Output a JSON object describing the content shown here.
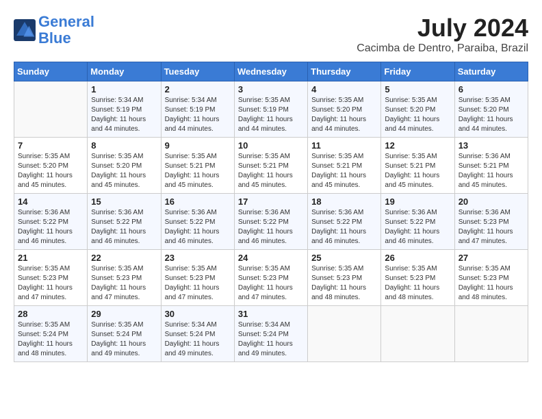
{
  "header": {
    "logo_line1": "General",
    "logo_line2": "Blue",
    "month_year": "July 2024",
    "location": "Cacimba de Dentro, Paraiba, Brazil"
  },
  "days_of_week": [
    "Sunday",
    "Monday",
    "Tuesday",
    "Wednesday",
    "Thursday",
    "Friday",
    "Saturday"
  ],
  "weeks": [
    [
      {
        "day": "",
        "info": ""
      },
      {
        "day": "1",
        "info": "Sunrise: 5:34 AM\nSunset: 5:19 PM\nDaylight: 11 hours\nand 44 minutes."
      },
      {
        "day": "2",
        "info": "Sunrise: 5:34 AM\nSunset: 5:19 PM\nDaylight: 11 hours\nand 44 minutes."
      },
      {
        "day": "3",
        "info": "Sunrise: 5:35 AM\nSunset: 5:19 PM\nDaylight: 11 hours\nand 44 minutes."
      },
      {
        "day": "4",
        "info": "Sunrise: 5:35 AM\nSunset: 5:20 PM\nDaylight: 11 hours\nand 44 minutes."
      },
      {
        "day": "5",
        "info": "Sunrise: 5:35 AM\nSunset: 5:20 PM\nDaylight: 11 hours\nand 44 minutes."
      },
      {
        "day": "6",
        "info": "Sunrise: 5:35 AM\nSunset: 5:20 PM\nDaylight: 11 hours\nand 44 minutes."
      }
    ],
    [
      {
        "day": "7",
        "info": "Sunrise: 5:35 AM\nSunset: 5:20 PM\nDaylight: 11 hours\nand 45 minutes."
      },
      {
        "day": "8",
        "info": "Sunrise: 5:35 AM\nSunset: 5:20 PM\nDaylight: 11 hours\nand 45 minutes."
      },
      {
        "day": "9",
        "info": "Sunrise: 5:35 AM\nSunset: 5:21 PM\nDaylight: 11 hours\nand 45 minutes."
      },
      {
        "day": "10",
        "info": "Sunrise: 5:35 AM\nSunset: 5:21 PM\nDaylight: 11 hours\nand 45 minutes."
      },
      {
        "day": "11",
        "info": "Sunrise: 5:35 AM\nSunset: 5:21 PM\nDaylight: 11 hours\nand 45 minutes."
      },
      {
        "day": "12",
        "info": "Sunrise: 5:35 AM\nSunset: 5:21 PM\nDaylight: 11 hours\nand 45 minutes."
      },
      {
        "day": "13",
        "info": "Sunrise: 5:36 AM\nSunset: 5:21 PM\nDaylight: 11 hours\nand 45 minutes."
      }
    ],
    [
      {
        "day": "14",
        "info": "Sunrise: 5:36 AM\nSunset: 5:22 PM\nDaylight: 11 hours\nand 46 minutes."
      },
      {
        "day": "15",
        "info": "Sunrise: 5:36 AM\nSunset: 5:22 PM\nDaylight: 11 hours\nand 46 minutes."
      },
      {
        "day": "16",
        "info": "Sunrise: 5:36 AM\nSunset: 5:22 PM\nDaylight: 11 hours\nand 46 minutes."
      },
      {
        "day": "17",
        "info": "Sunrise: 5:36 AM\nSunset: 5:22 PM\nDaylight: 11 hours\nand 46 minutes."
      },
      {
        "day": "18",
        "info": "Sunrise: 5:36 AM\nSunset: 5:22 PM\nDaylight: 11 hours\nand 46 minutes."
      },
      {
        "day": "19",
        "info": "Sunrise: 5:36 AM\nSunset: 5:22 PM\nDaylight: 11 hours\nand 46 minutes."
      },
      {
        "day": "20",
        "info": "Sunrise: 5:36 AM\nSunset: 5:23 PM\nDaylight: 11 hours\nand 47 minutes."
      }
    ],
    [
      {
        "day": "21",
        "info": "Sunrise: 5:35 AM\nSunset: 5:23 PM\nDaylight: 11 hours\nand 47 minutes."
      },
      {
        "day": "22",
        "info": "Sunrise: 5:35 AM\nSunset: 5:23 PM\nDaylight: 11 hours\nand 47 minutes."
      },
      {
        "day": "23",
        "info": "Sunrise: 5:35 AM\nSunset: 5:23 PM\nDaylight: 11 hours\nand 47 minutes."
      },
      {
        "day": "24",
        "info": "Sunrise: 5:35 AM\nSunset: 5:23 PM\nDaylight: 11 hours\nand 47 minutes."
      },
      {
        "day": "25",
        "info": "Sunrise: 5:35 AM\nSunset: 5:23 PM\nDaylight: 11 hours\nand 48 minutes."
      },
      {
        "day": "26",
        "info": "Sunrise: 5:35 AM\nSunset: 5:23 PM\nDaylight: 11 hours\nand 48 minutes."
      },
      {
        "day": "27",
        "info": "Sunrise: 5:35 AM\nSunset: 5:23 PM\nDaylight: 11 hours\nand 48 minutes."
      }
    ],
    [
      {
        "day": "28",
        "info": "Sunrise: 5:35 AM\nSunset: 5:24 PM\nDaylight: 11 hours\nand 48 minutes."
      },
      {
        "day": "29",
        "info": "Sunrise: 5:35 AM\nSunset: 5:24 PM\nDaylight: 11 hours\nand 49 minutes."
      },
      {
        "day": "30",
        "info": "Sunrise: 5:34 AM\nSunset: 5:24 PM\nDaylight: 11 hours\nand 49 minutes."
      },
      {
        "day": "31",
        "info": "Sunrise: 5:34 AM\nSunset: 5:24 PM\nDaylight: 11 hours\nand 49 minutes."
      },
      {
        "day": "",
        "info": ""
      },
      {
        "day": "",
        "info": ""
      },
      {
        "day": "",
        "info": ""
      }
    ]
  ]
}
